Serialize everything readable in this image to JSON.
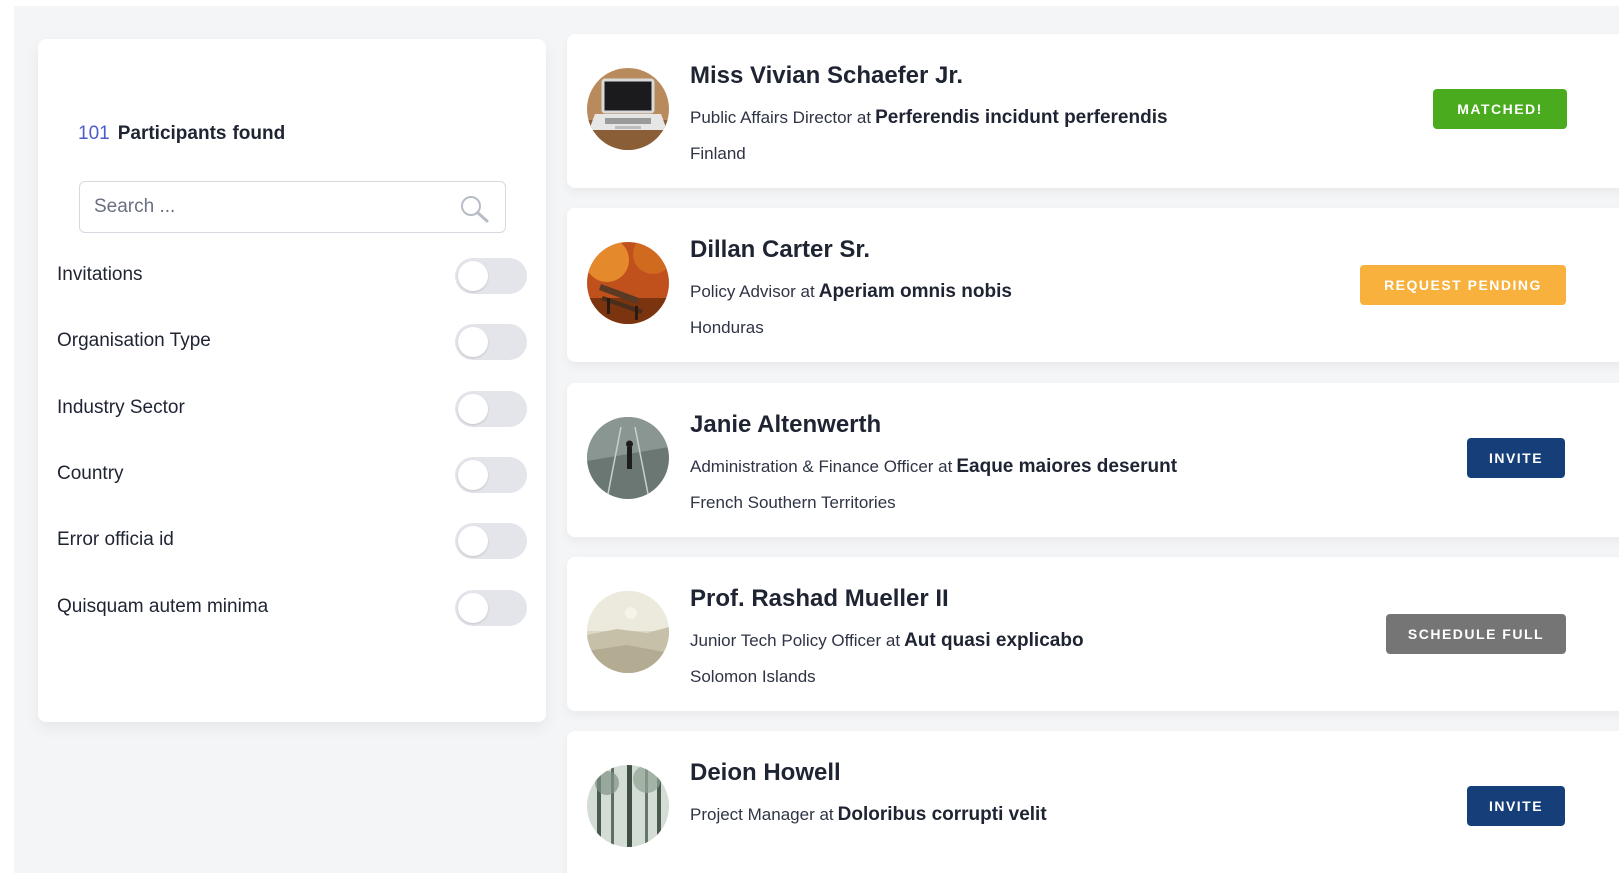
{
  "sidebar": {
    "count": "101",
    "count_word1": "Participants",
    "count_word2": "found",
    "search_placeholder": "Search ...",
    "filters": [
      {
        "label": "Invitations",
        "on": false
      },
      {
        "label": "Organisation Type",
        "on": false
      },
      {
        "label": "Industry Sector",
        "on": false
      },
      {
        "label": "Country",
        "on": false
      },
      {
        "label": "Error officia id",
        "on": false
      },
      {
        "label": "Quisquam autem minima",
        "on": false
      }
    ]
  },
  "participants": [
    {
      "name": "Miss Vivian Schaefer Jr.",
      "title": "Public Affairs Director at",
      "organisation": "Perferendis incidunt perferendis",
      "country": "Finland",
      "status": "MATCHED!",
      "status_color": "#4aab1f",
      "avatar": "laptop-photo"
    },
    {
      "name": "Dillan Carter Sr.",
      "title": "Policy Advisor at",
      "organisation": "Aperiam omnis nobis",
      "country": "Honduras",
      "status": "REQUEST PENDING",
      "status_color": "#f8b13c",
      "avatar": "bench-autumn-photo"
    },
    {
      "name": "Janie Altenwerth",
      "title": "Administration & Finance Officer at",
      "organisation": "Eaque maiores deserunt",
      "country": "French Southern Territories",
      "status": "INVITE",
      "status_color": "#163f7a",
      "avatar": "road-walker-photo"
    },
    {
      "name": "Prof. Rashad Mueller II",
      "title": "Junior Tech Policy Officer at",
      "organisation": "Aut quasi explicabo",
      "country": "Solomon Islands",
      "status": "SCHEDULE FULL",
      "status_color": "#757575",
      "avatar": "foggy-landscape-photo"
    },
    {
      "name": "Deion Howell",
      "title": "Project Manager at",
      "organisation": "Doloribus corrupti velit",
      "country": "",
      "status": "INVITE",
      "status_color": "#163f7a",
      "avatar": "forest-photo"
    }
  ]
}
